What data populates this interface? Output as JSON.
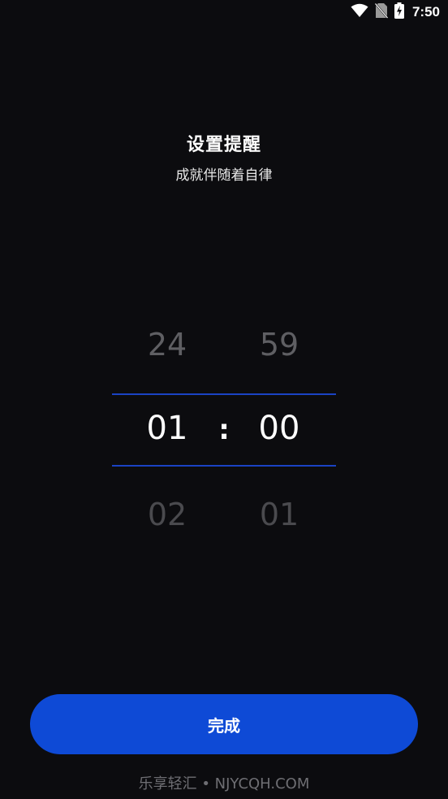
{
  "status_bar": {
    "time": "7:50",
    "icons": [
      "wifi-icon",
      "no-sim-icon",
      "battery-charging-icon"
    ]
  },
  "header": {
    "title": "设置提醒",
    "subtitle": "成就伴随着自律"
  },
  "time_picker": {
    "separator": ":",
    "hours": {
      "previous": "24",
      "selected": "01",
      "next": "02"
    },
    "minutes": {
      "previous": "59",
      "selected": "00",
      "next": "01"
    },
    "accent_color": "#1a43c4"
  },
  "actions": {
    "done_label": "完成",
    "button_color": "#0e4ad6"
  },
  "watermark": {
    "text": "乐享轻汇 • NJYCQH.COM"
  }
}
